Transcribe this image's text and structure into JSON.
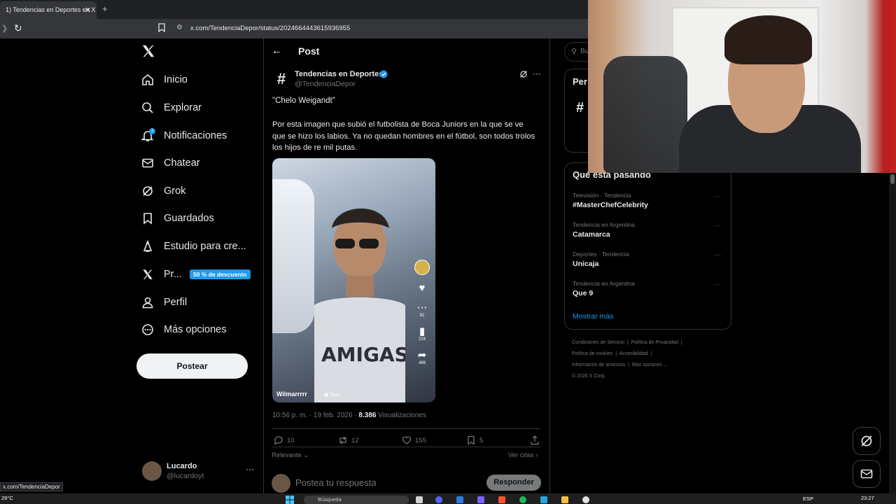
{
  "browser": {
    "tab_title": "1) Tendencias en Deportes en X",
    "tab_close": "✕",
    "tab_add": "+",
    "url": "x.com/TendenciaDepor/status/2024664443615936955",
    "status_url": "x.com/TendenciaDepor"
  },
  "sidebar": {
    "items": [
      {
        "label": "Inicio",
        "icon": "home-icon"
      },
      {
        "label": "Explorar",
        "icon": "search-icon"
      },
      {
        "label": "Notificaciones",
        "icon": "bell-icon"
      },
      {
        "label": "Chatear",
        "icon": "mail-icon"
      },
      {
        "label": "Grok",
        "icon": "grok-icon"
      },
      {
        "label": "Guardados",
        "icon": "bookmark-icon"
      },
      {
        "label": "Estudio para cre...",
        "icon": "creator-icon"
      },
      {
        "label": "Pr...",
        "icon": "x-premium-icon"
      },
      {
        "label": "Perfil",
        "icon": "person-icon"
      },
      {
        "label": "Más opciones",
        "icon": "more-circle-icon"
      }
    ],
    "notif_badge": "1",
    "promo": "50 % de descuento",
    "post_button": "Postear",
    "user": {
      "name": "Lucardo",
      "handle": "@lucardoyt"
    }
  },
  "post": {
    "header_title": "Post",
    "account_name": "Tendencias en Deportes",
    "account_handle": "@TendenciaDepor",
    "quote": "\"Chelo Weigandt\"",
    "body": "Por esta imagen que subió el futbolista de Boca Juniors en la que se ve que se hizo los labios. Ya no quedan hombres en el fútbol, son todos trolos los hijos de re mil putas.",
    "media": {
      "username": "Wilmarrrrr",
      "tag": "▣ Foto",
      "counts": [
        "92",
        "224",
        "489"
      ]
    },
    "time": "10:56 p. m. · 19 feb. 2026 ·",
    "views_count": "8.386",
    "views_label": "Visualizaciones",
    "stats": {
      "replies": "10",
      "reposts": "12",
      "likes": "155",
      "bookmarks": "5"
    },
    "sort_label": "Relevante",
    "quotes_link": "Ver citas",
    "reply_placeholder": "Postea tu respuesta",
    "reply_button": "Responder"
  },
  "right": {
    "search_placeholder": "Bu",
    "relevant_title": "Per",
    "relevant_hash": "#",
    "trends_title": "Qué está pasando",
    "trends": [
      {
        "context": "Televisión · Tendencia",
        "name": "#MasterChefCelebrity"
      },
      {
        "context": "Tendencia en Argentina",
        "name": "Catamarca"
      },
      {
        "context": "Deportes · Tendencia",
        "name": "Unicaja"
      },
      {
        "context": "Tendencia en Argentina",
        "name": "Que 9"
      }
    ],
    "show_more": "Mostrar más",
    "footer": [
      "Condiciones de Servicio",
      "Política de Privacidad",
      "Política de cookies",
      "Accesibilidad",
      "Información de anuncios",
      "Más opciones ...",
      "© 2026 X Corp."
    ]
  },
  "taskbar": {
    "weather": "29°C",
    "search": "Búsqueda",
    "lang": "ESP",
    "time": "23:27"
  },
  "colors": {
    "accent": "#1d9bf0",
    "background": "#000000",
    "border": "#2f3336",
    "muted": "#71767b"
  }
}
